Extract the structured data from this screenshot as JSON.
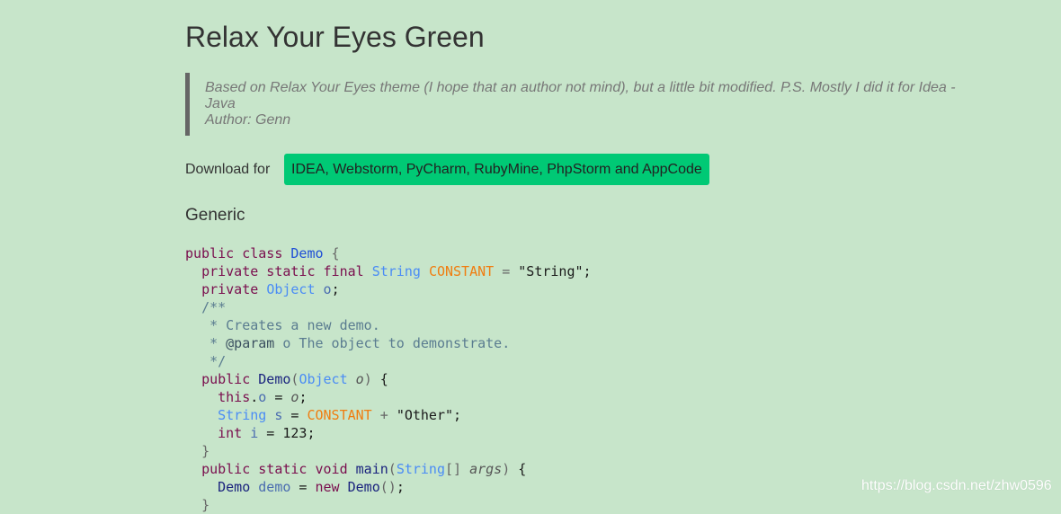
{
  "page": {
    "title": "Relax Your Eyes Green"
  },
  "quote": {
    "line1": "Based on Relax Your Eyes theme (I hope that an author not mind), but a little bit modified. P.S. Mostly I did it for Idea -",
    "line2": "Java",
    "line3": "Author: Genn"
  },
  "download": {
    "label": "Download for",
    "button_label": "IDEA, Webstorm, PyCharm, RubyMine, PhpStorm and AppCode"
  },
  "section": {
    "title": "Generic"
  },
  "code_colors": {
    "keyword": "#7a0e4e",
    "class_name": "#1f4fd6",
    "type": "#4a8cf5",
    "constant": "#f07d10",
    "comment": "#5a7c90",
    "background": "#c7e5ca",
    "button": "#00c975"
  },
  "code_lines": [
    [
      [
        "kw",
        "public class "
      ],
      [
        "cls",
        "Demo"
      ],
      [
        "p",
        " {"
      ]
    ],
    [
      [
        "n",
        "  "
      ],
      [
        "kw",
        "private static final "
      ],
      [
        "type",
        "String "
      ],
      [
        "const",
        "CONSTANT"
      ],
      [
        "p",
        " = "
      ],
      [
        "str",
        "\"String\""
      ],
      [
        "n",
        ";"
      ]
    ],
    [
      [
        "n",
        "  "
      ],
      [
        "kw",
        "private "
      ],
      [
        "type",
        "Object "
      ],
      [
        "var",
        "o"
      ],
      [
        "n",
        ";"
      ]
    ],
    [
      [
        "n",
        "  "
      ],
      [
        "cm",
        "/**"
      ]
    ],
    [
      [
        "n",
        "   "
      ],
      [
        "cm",
        "* Creates a new demo."
      ]
    ],
    [
      [
        "n",
        "   "
      ],
      [
        "cm",
        "* "
      ],
      [
        "tag",
        "@param"
      ],
      [
        "cm",
        " o The object to demonstrate."
      ]
    ],
    [
      [
        "n",
        "   "
      ],
      [
        "cm",
        "*/"
      ]
    ],
    [
      [
        "n",
        "  "
      ],
      [
        "kw",
        "public "
      ],
      [
        "fn",
        "Demo"
      ],
      [
        "p",
        "("
      ],
      [
        "type",
        "Object "
      ],
      [
        "it",
        "o"
      ],
      [
        "p",
        ")"
      ],
      [
        "n",
        " {"
      ]
    ],
    [
      [
        "n",
        "    "
      ],
      [
        "kw",
        "this"
      ],
      [
        "n",
        "."
      ],
      [
        "var",
        "o"
      ],
      [
        "n",
        " = "
      ],
      [
        "it",
        "o"
      ],
      [
        "n",
        ";"
      ]
    ],
    [
      [
        "n",
        "    "
      ],
      [
        "type",
        "String "
      ],
      [
        "var",
        "s"
      ],
      [
        "n",
        " = "
      ],
      [
        "const",
        "CONSTANT"
      ],
      [
        "p",
        " + "
      ],
      [
        "str",
        "\"Other\""
      ],
      [
        "n",
        ";"
      ]
    ],
    [
      [
        "n",
        "    "
      ],
      [
        "kw",
        "int "
      ],
      [
        "var",
        "i"
      ],
      [
        "n",
        " = 123;"
      ]
    ],
    [
      [
        "n",
        "  "
      ],
      [
        "p",
        "}"
      ]
    ],
    [
      [
        "n",
        "  "
      ],
      [
        "kw",
        "public static void "
      ],
      [
        "fn",
        "main"
      ],
      [
        "p",
        "("
      ],
      [
        "type",
        "String"
      ],
      [
        "p",
        "[] "
      ],
      [
        "it",
        "args"
      ],
      [
        "p",
        ")"
      ],
      [
        "n",
        " {"
      ]
    ],
    [
      [
        "n",
        "    "
      ],
      [
        "fn",
        "Demo "
      ],
      [
        "var",
        "demo"
      ],
      [
        "n",
        " = "
      ],
      [
        "kw",
        "new "
      ],
      [
        "fn",
        "Demo"
      ],
      [
        "p",
        "()"
      ],
      [
        "n",
        ";"
      ]
    ],
    [
      [
        "n",
        "  "
      ],
      [
        "p",
        "}"
      ]
    ]
  ],
  "watermark": "https://blog.csdn.net/zhw0596"
}
